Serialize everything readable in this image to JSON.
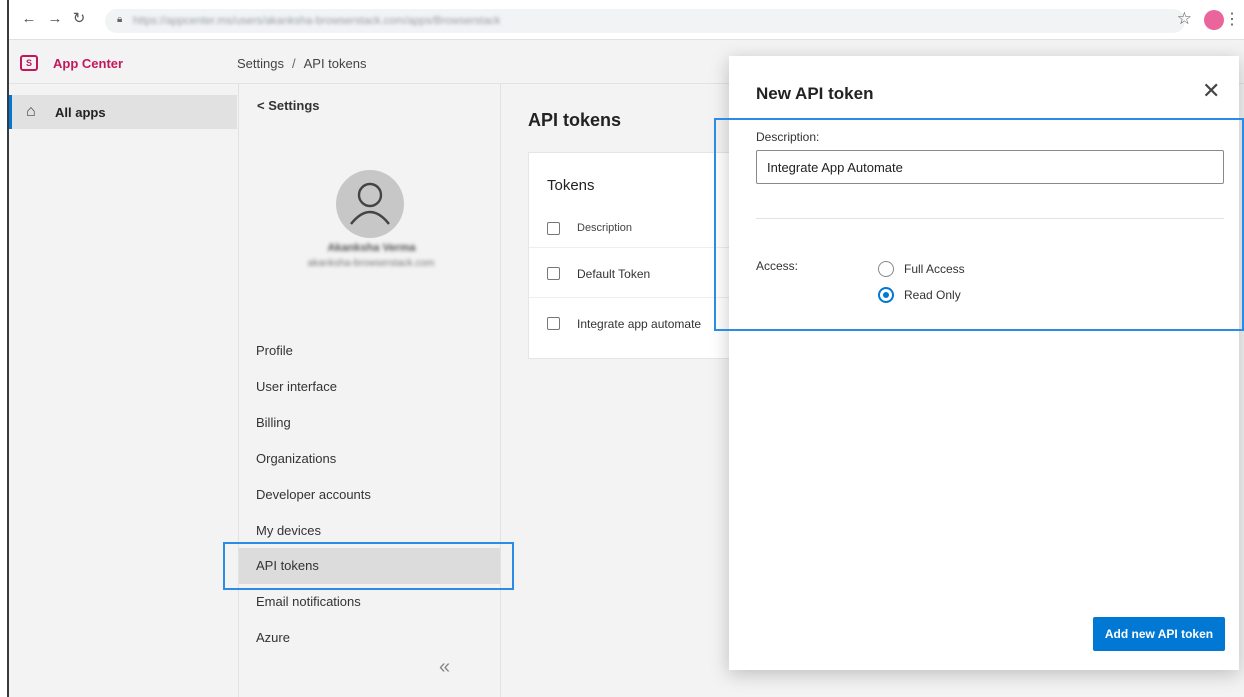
{
  "browser": {
    "url": "https://appcenter.ms/users/akanksha-browserstack.com/apps/Browserstack"
  },
  "app": {
    "name": "App Center",
    "logo_text": "S"
  },
  "breadcrumb": {
    "root": "Settings",
    "separator": "/",
    "current": "API tokens"
  },
  "left_nav": {
    "all_apps": "All apps"
  },
  "settings_panel": {
    "back_label": "< Settings",
    "user_name": "Akanksha Verma",
    "user_email": "akanksha-browserstack.com",
    "menu": [
      "Profile",
      "User interface",
      "Billing",
      "Organizations",
      "Developer accounts",
      "My devices",
      "API tokens",
      "Email notifications",
      "Azure"
    ],
    "active_item": "API tokens"
  },
  "main": {
    "title": "API tokens",
    "tokens_card": {
      "title": "Tokens",
      "header": "Description",
      "rows": [
        "Default Token",
        "Integrate app automate"
      ]
    }
  },
  "modal": {
    "title": "New API token",
    "description_label": "Description:",
    "description_value": "Integrate App Automate",
    "access_label": "Access:",
    "options": [
      "Full Access",
      "Read Only"
    ],
    "selected_option": "Read Only",
    "submit_label": "Add new API token"
  },
  "colors": {
    "accent": "#0078d4",
    "brand": "#c2185b",
    "highlight": "#2b8be6"
  }
}
